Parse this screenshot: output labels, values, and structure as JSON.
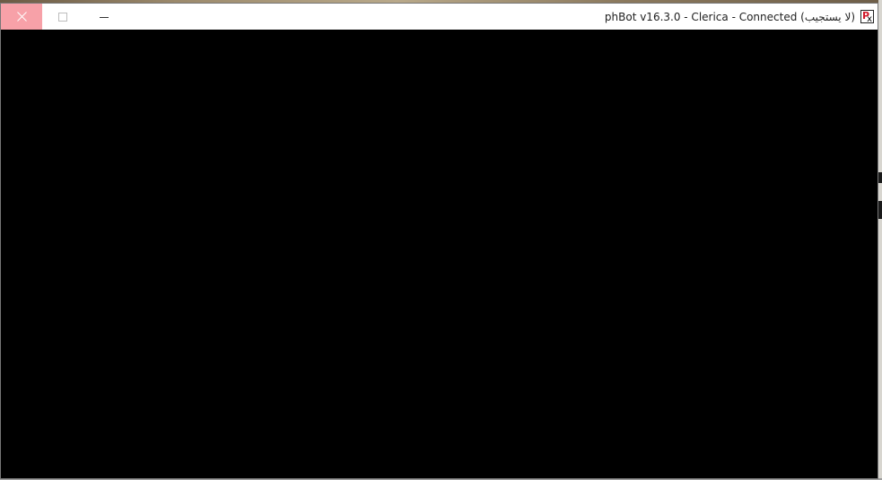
{
  "window": {
    "title": "phBot v16.3.0 - Clerica - Connected (لا يستجيب)",
    "controls": {
      "close_icon": "close-icon",
      "maximize_icon": "maximize-icon",
      "minimize_icon": "minimize-icon"
    },
    "app_icon": "phbot-app-icon",
    "colors": {
      "close_button_bg": "#f7a1a8",
      "client_area": "#000000",
      "titlebar": "#ffffff"
    }
  }
}
